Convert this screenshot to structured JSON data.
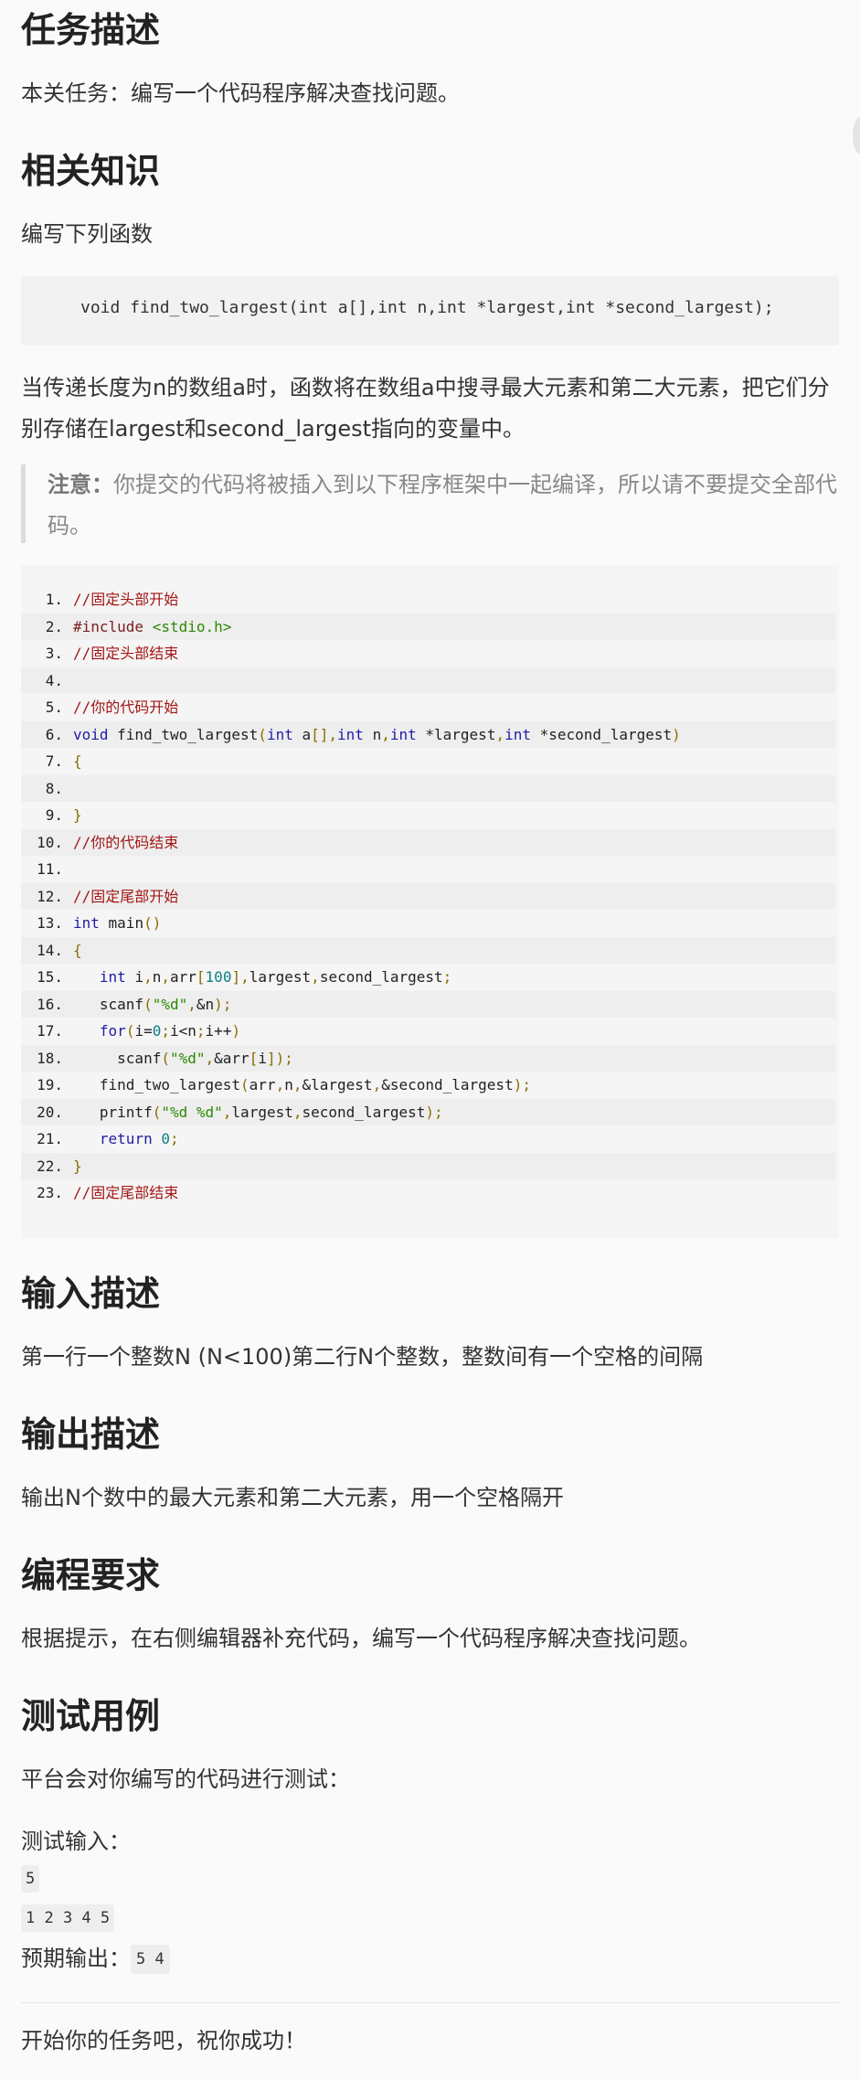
{
  "sections": {
    "task": {
      "title": "任务描述",
      "text": "本关任务：编写一个代码程序解决查找问题。"
    },
    "knowledge": {
      "title": "相关知识",
      "intro": "编写下列函数",
      "signature": "void find_two_largest(int a[],int n,int *largest,int *second_largest);",
      "explain": "当传递长度为n的数组a时，函数将在数组a中搜寻最大元素和第二大元素，把它们分别存储在largest和second_largest指向的变量中。",
      "note_label": "注意：",
      "note_text": "你提交的代码将被插入到以下程序框架中一起编译，所以请不要提交全部代码。"
    },
    "input": {
      "title": "输入描述",
      "text": "第一行一个整数N (N<100)第二行N个整数，整数间有一个空格的间隔"
    },
    "output": {
      "title": "输出描述",
      "text": "输出N个数中的最大元素和第二大元素，用一个空格隔开"
    },
    "requirement": {
      "title": "编程要求",
      "text": "根据提示，在右侧编辑器补充代码，编写一个代码程序解决查找问题。"
    },
    "test": {
      "title": "测试用例",
      "intro": "平台会对你编写的代码进行测试：",
      "input_label": "测试输入：",
      "input_line1": "5",
      "input_line2": "1 2 3 4 5",
      "expected_label": "预期输出：",
      "expected": "5 4"
    },
    "closing": "开始你的任务吧，祝你成功！"
  },
  "listing": [
    {
      "n": "1.",
      "code": "//固定头部开始"
    },
    {
      "n": "2.",
      "code": "#include <stdio.h>"
    },
    {
      "n": "3.",
      "code": "//固定头部结束"
    },
    {
      "n": "4.",
      "code": ""
    },
    {
      "n": "5.",
      "code": "//你的代码开始"
    },
    {
      "n": "6.",
      "code": "void find_two_largest(int a[],int n,int *largest,int *second_largest)"
    },
    {
      "n": "7.",
      "code": "{"
    },
    {
      "n": "8.",
      "code": ""
    },
    {
      "n": "9.",
      "code": "}"
    },
    {
      "n": "10.",
      "code": "//你的代码结束"
    },
    {
      "n": "11.",
      "code": ""
    },
    {
      "n": "12.",
      "code": "//固定尾部开始"
    },
    {
      "n": "13.",
      "code": "int main()"
    },
    {
      "n": "14.",
      "code": "{"
    },
    {
      "n": "15.",
      "code": "   int i,n,arr[100],largest,second_largest;"
    },
    {
      "n": "16.",
      "code": "   scanf(\"%d\",&n);"
    },
    {
      "n": "17.",
      "code": "   for(i=0;i<n;i++)"
    },
    {
      "n": "18.",
      "code": "     scanf(\"%d\",&arr[i]);"
    },
    {
      "n": "19.",
      "code": "   find_two_largest(arr,n,&largest,&second_largest);"
    },
    {
      "n": "20.",
      "code": "   printf(\"%d %d\",largest,second_largest);"
    },
    {
      "n": "21.",
      "code": "   return 0;"
    },
    {
      "n": "22.",
      "code": "}"
    },
    {
      "n": "23.",
      "code": "//固定尾部结束"
    }
  ]
}
